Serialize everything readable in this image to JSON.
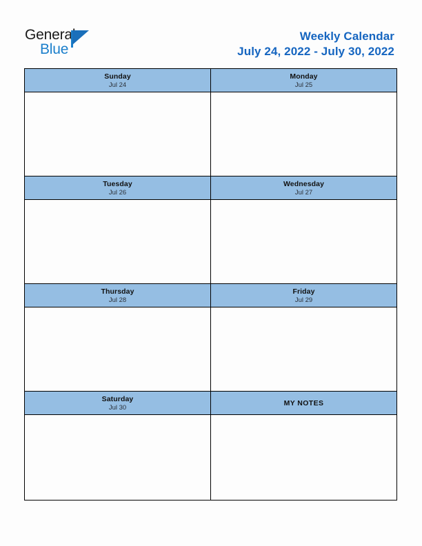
{
  "logo": {
    "word_one": "General",
    "word_two": "Blue",
    "triangle_icon": "triangle-icon",
    "brand_blue": "#1b7fcb"
  },
  "header": {
    "title": "Weekly Calendar",
    "date_range": "July 24, 2022 - July 30, 2022",
    "title_color": "#1565c0"
  },
  "calendar": {
    "header_background": "#95bee3",
    "border_color": "#000000",
    "cell_background": "#fdfdfd",
    "rows": [
      {
        "cells": [
          {
            "kind": "day",
            "name": "Sunday",
            "date": "Jul 24"
          },
          {
            "kind": "day",
            "name": "Monday",
            "date": "Jul 25"
          }
        ]
      },
      {
        "cells": [
          {
            "kind": "day",
            "name": "Tuesday",
            "date": "Jul 26"
          },
          {
            "kind": "day",
            "name": "Wednesday",
            "date": "Jul 27"
          }
        ]
      },
      {
        "cells": [
          {
            "kind": "day",
            "name": "Thursday",
            "date": "Jul 28"
          },
          {
            "kind": "day",
            "name": "Friday",
            "date": "Jul 29"
          }
        ]
      },
      {
        "cells": [
          {
            "kind": "day",
            "name": "Saturday",
            "date": "Jul 30"
          },
          {
            "kind": "notes",
            "name": "MY NOTES",
            "date": ""
          }
        ]
      }
    ]
  }
}
